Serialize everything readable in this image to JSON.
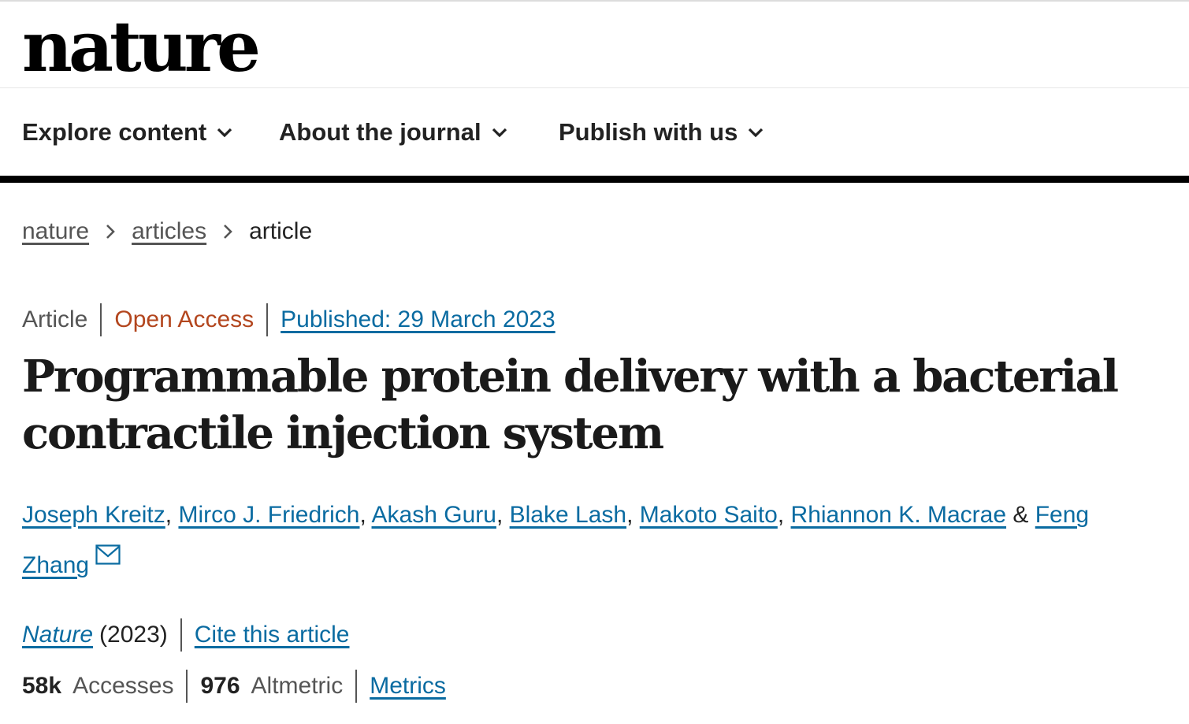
{
  "site": {
    "logo_text": "nature"
  },
  "nav": {
    "items": [
      {
        "label": "Explore content",
        "icon": "chevron-down-icon"
      },
      {
        "label": "About the journal",
        "icon": "chevron-down-icon"
      },
      {
        "label": "Publish with us",
        "icon": "chevron-down-icon"
      }
    ]
  },
  "breadcrumb": {
    "items": [
      "nature",
      "articles"
    ],
    "current": "article",
    "separator_icon": "chevron-right-icon"
  },
  "article": {
    "type": "Article",
    "access": "Open Access",
    "published": "Published: 29 March 2023",
    "title": "Programmable protein delivery with a bacterial contractile injection system",
    "authors": [
      "Joseph Kreitz",
      "Mirco J. Friedrich",
      "Akash Guru",
      "Blake Lash",
      "Makoto Saito",
      "Rhiannon K. Macrae",
      "Feng Zhang"
    ],
    "author_sep": ",",
    "author_last_sep": "&",
    "contact_icon": "envelope-icon",
    "journal": "Nature",
    "year": "(2023)",
    "cite_label": "Cite this article"
  },
  "metrics": {
    "accesses_value": "58k",
    "accesses_label": "Accesses",
    "altmetric_value": "976",
    "altmetric_label": "Altmetric",
    "metrics_link": "Metrics"
  },
  "colors": {
    "link": "#0a6ba1",
    "open_access": "#b3461e",
    "text": "#222222",
    "muted": "#555555"
  }
}
